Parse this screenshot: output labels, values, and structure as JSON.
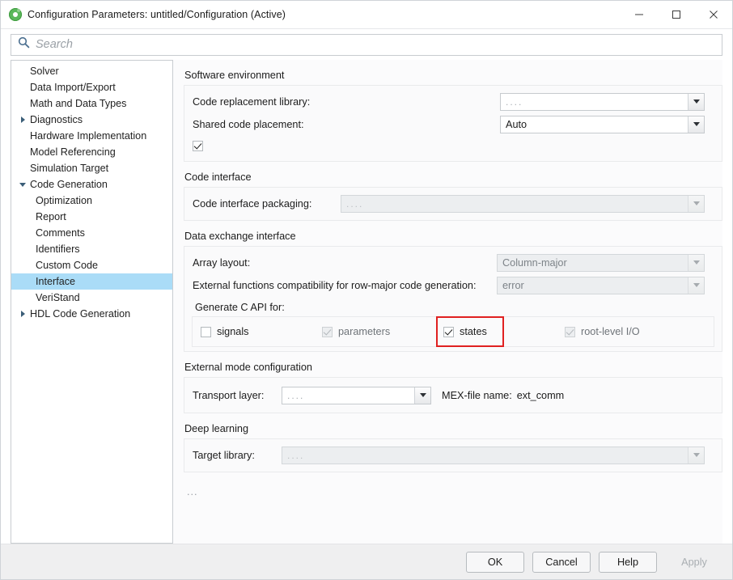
{
  "window": {
    "title": "Configuration Parameters: untitled/Configuration (Active)",
    "app_icon": "simulink-icon",
    "minimize_label": "─",
    "maximize_label": "□",
    "close_label": "×"
  },
  "search": {
    "icon": "search-icon",
    "placeholder": "Search",
    "value": ""
  },
  "tree": {
    "selected": "Interface",
    "items": [
      {
        "label": "Solver",
        "level": 0,
        "twisty": "none",
        "selected": false
      },
      {
        "label": "Data Import/Export",
        "level": 0,
        "twisty": "none",
        "selected": false
      },
      {
        "label": "Math and Data Types",
        "level": 0,
        "twisty": "none",
        "selected": false
      },
      {
        "label": "Diagnostics",
        "level": 0,
        "twisty": "collapsed",
        "selected": false
      },
      {
        "label": "Hardware Implementation",
        "level": 0,
        "twisty": "none",
        "selected": false
      },
      {
        "label": "Model Referencing",
        "level": 0,
        "twisty": "none",
        "selected": false
      },
      {
        "label": "Simulation Target",
        "level": 0,
        "twisty": "none",
        "selected": false
      },
      {
        "label": "Code Generation",
        "level": 0,
        "twisty": "expanded",
        "selected": false
      },
      {
        "label": "Optimization",
        "level": 1,
        "twisty": "none",
        "selected": false
      },
      {
        "label": "Report",
        "level": 1,
        "twisty": "none",
        "selected": false
      },
      {
        "label": "Comments",
        "level": 1,
        "twisty": "none",
        "selected": false
      },
      {
        "label": "Identifiers",
        "level": 1,
        "twisty": "none",
        "selected": false
      },
      {
        "label": "Custom Code",
        "level": 1,
        "twisty": "none",
        "selected": false
      },
      {
        "label": "Interface",
        "level": 1,
        "twisty": "none",
        "selected": true
      },
      {
        "label": "VeriStand",
        "level": 1,
        "twisty": "none",
        "selected": false
      },
      {
        "label": "HDL Code Generation",
        "level": 0,
        "twisty": "collapsed",
        "selected": false
      }
    ]
  },
  "panel": {
    "software_environment": {
      "title": "Software environment",
      "code_replacement_library": {
        "label": "Code replacement library:",
        "value": "....",
        "disabled": false
      },
      "shared_code_placement": {
        "label": "Shared code placement:",
        "value": "Auto",
        "disabled": false
      },
      "unnamed_checkbox": {
        "label": "",
        "checked": true,
        "disabled": false
      }
    },
    "code_interface": {
      "title": "Code interface",
      "code_interface_packaging": {
        "label": "Code interface packaging:",
        "value": "....",
        "disabled": true
      }
    },
    "data_exchange_interface": {
      "title": "Data exchange interface",
      "array_layout": {
        "label": "Array layout:",
        "value": "Column-major",
        "disabled": true
      },
      "external_functions_compatibility": {
        "label": "External functions compatibility for row-major code generation:",
        "value": "error",
        "disabled": true
      },
      "generate_c_api_label": "Generate C API for:",
      "generate_c_api": [
        {
          "label": "signals",
          "checked": false,
          "disabled": false,
          "highlighted": false
        },
        {
          "label": "parameters",
          "checked": true,
          "disabled": true,
          "highlighted": false
        },
        {
          "label": "states",
          "checked": true,
          "disabled": false,
          "highlighted": true
        },
        {
          "label": "root-level I/O",
          "checked": true,
          "disabled": true,
          "highlighted": false
        }
      ]
    },
    "external_mode_configuration": {
      "title": "External mode configuration",
      "transport_layer": {
        "label": "Transport layer:",
        "value": "....",
        "disabled": false
      },
      "mex_file_name_label": "MEX-file name:",
      "mex_file_name_value": "ext_comm"
    },
    "deep_learning": {
      "title": "Deep learning",
      "target_library": {
        "label": "Target library:",
        "value": "....",
        "disabled": true
      }
    },
    "trailing_note": "..."
  },
  "footer": {
    "buttons": [
      {
        "label": "OK",
        "disabled": false
      },
      {
        "label": "Cancel",
        "disabled": false
      },
      {
        "label": "Help",
        "disabled": false
      },
      {
        "label": "Apply",
        "disabled": true
      }
    ]
  },
  "colors": {
    "selection": "#aadcf7",
    "highlight_box": "#e02020",
    "app_icon_green": "#5bb75b",
    "search_icon_blue": "#4a6e8f"
  }
}
